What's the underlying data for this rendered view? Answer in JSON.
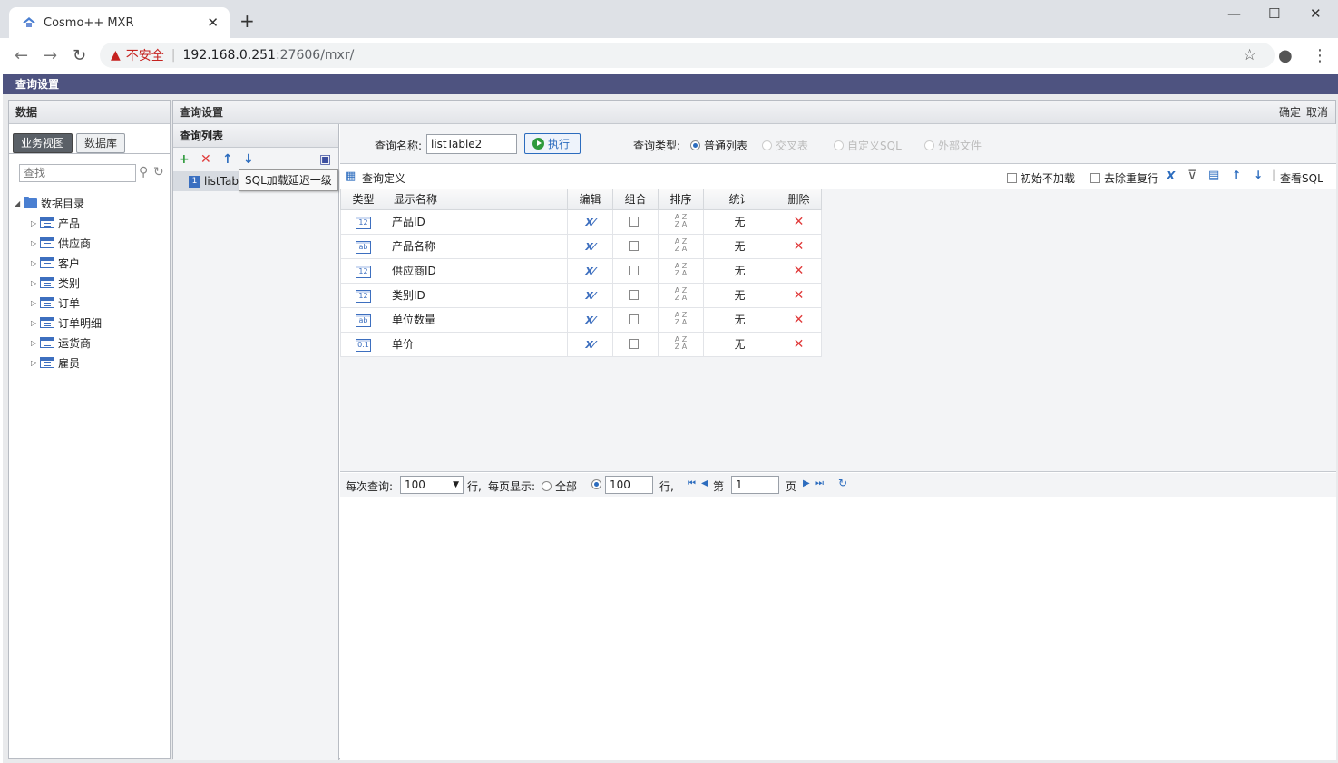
{
  "browser": {
    "tab_title": "Cosmo++ MXR",
    "new_tab": "+",
    "address": {
      "warning": "不安全",
      "host": "192.168.0.251",
      "path": ":27606/mxr/"
    }
  },
  "app": {
    "title": "查询设置",
    "accent": "#4e5380",
    "left": {
      "title": "数据",
      "tabs": [
        "业务视图",
        "数据库"
      ],
      "search_placeholder": "查找",
      "root": "数据目录",
      "nodes": [
        "产品",
        "供应商",
        "客户",
        "类别",
        "订单",
        "订单明细",
        "运货商",
        "雇员"
      ]
    },
    "main": {
      "title": "查询设置",
      "ok": "确定",
      "cancel": "取消",
      "list": {
        "title": "查询列表",
        "item": "listTabl",
        "tooltip": "SQL加载延迟一级"
      },
      "query": {
        "name_label": "查询名称:",
        "name_value": "listTable2",
        "run": "执行",
        "type_label": "查询类型:",
        "types": [
          "普通列表",
          "交叉表",
          "自定义SQL",
          "外部文件"
        ]
      },
      "def": {
        "title": "查询定义",
        "opt1": "初始不加载",
        "opt2": "去除重复行",
        "view_sql": "查看SQL"
      },
      "grid": {
        "headers": [
          "类型",
          "显示名称",
          "编辑",
          "组合",
          "排序",
          "统计",
          "删除"
        ],
        "rows": [
          {
            "type": "12",
            "name": "产品ID",
            "stat": "无"
          },
          {
            "type": "ab",
            "name": "产品名称",
            "stat": "无"
          },
          {
            "type": "12",
            "name": "供应商ID",
            "stat": "无"
          },
          {
            "type": "12",
            "name": "类别ID",
            "stat": "无"
          },
          {
            "type": "ab",
            "name": "单位数量",
            "stat": "无"
          },
          {
            "type": "0.1",
            "name": "单价",
            "stat": "无"
          }
        ]
      },
      "pager": {
        "per_query_label": "每次查询:",
        "per_query": "100",
        "rows_label": "行,",
        "per_page_label": "每页显示:",
        "all": "全部",
        "per_page": "100",
        "rows_label2": "行,",
        "page_prefix": "第",
        "page": "1",
        "page_suffix": "页"
      }
    }
  }
}
